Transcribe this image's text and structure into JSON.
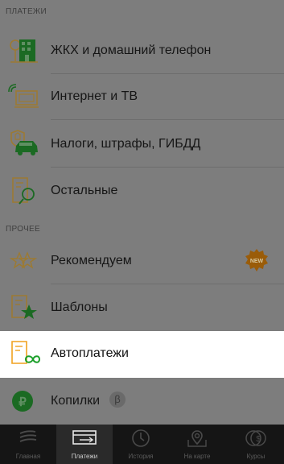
{
  "sections": {
    "payments": {
      "title": "ПЛАТЕЖИ"
    },
    "other": {
      "title": "ПРОЧЕЕ"
    }
  },
  "payments_items": [
    {
      "label": "ЖКХ и домашний телефон",
      "icon": "building-icon"
    },
    {
      "label": "Интернет и ТВ",
      "icon": "monitor-icon"
    },
    {
      "label": "Налоги, штрафы, ГИБДД",
      "icon": "car-shield-icon"
    },
    {
      "label": "Остальные",
      "icon": "document-search-icon"
    }
  ],
  "other_items": [
    {
      "label": "Рекомендуем",
      "icon": "stars-icon",
      "badge": "NEW"
    },
    {
      "label": "Шаблоны",
      "icon": "document-star-icon"
    },
    {
      "label": "Автоплатежи",
      "icon": "document-infinity-icon",
      "highlighted": true
    },
    {
      "label": "Копилки",
      "icon": "piggy-ruble-icon",
      "badge": "β"
    }
  ],
  "tabs": [
    {
      "label": "Главная",
      "icon": "bank-logo-icon"
    },
    {
      "label": "Платежи",
      "icon": "transfer-icon",
      "active": true
    },
    {
      "label": "История",
      "icon": "clock-icon"
    },
    {
      "label": "На карте",
      "icon": "map-pin-icon"
    },
    {
      "label": "Курсы",
      "icon": "currency-icon"
    }
  ],
  "colors": {
    "accent_green": "#1a9f29",
    "accent_orange": "#f0a11f",
    "badge_orange": "#e88f0c"
  }
}
